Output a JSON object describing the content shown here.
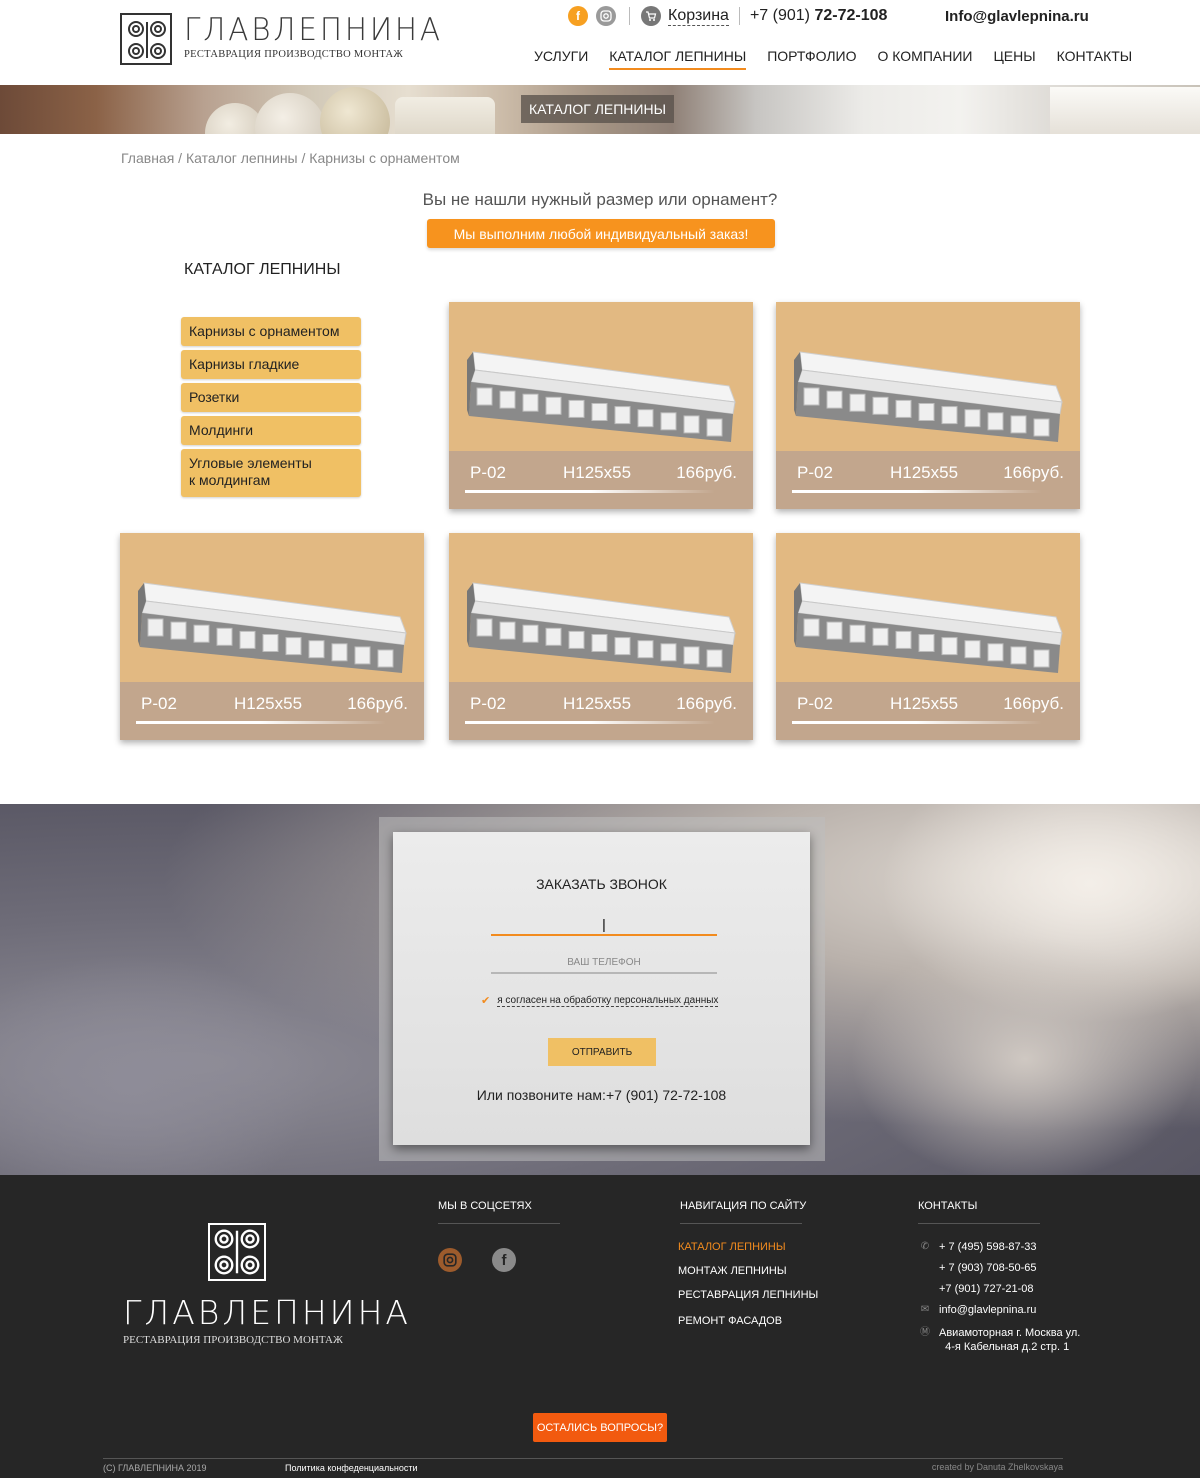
{
  "brand": {
    "name": "ГЛАВЛЕПНИНА",
    "tagline": "РЕСТАВРАЦИЯ ПРОИЗВОДСТВО МОНТАЖ"
  },
  "topbar": {
    "cart_label": "Корзина",
    "phone_prefix": "+7 (901)",
    "phone_number": "72-72-108",
    "email": "Info@glavlepnina.ru",
    "social_icons": [
      "facebook-icon",
      "instagram-icon"
    ]
  },
  "nav": {
    "items": [
      {
        "label": "УСЛУГИ",
        "active": false
      },
      {
        "label": "КАТАЛОГ ЛЕПНИНЫ",
        "active": true
      },
      {
        "label": "ПОРТФОЛИО",
        "active": false
      },
      {
        "label": "О КОМПАНИИ",
        "active": false
      },
      {
        "label": "ЦЕНЫ",
        "active": false
      },
      {
        "label": "КОНТАКТЫ",
        "active": false
      }
    ]
  },
  "banner": {
    "title": "КАТАЛОГ ЛЕПНИНЫ"
  },
  "breadcrumb": {
    "text": "Главная / Каталог лепнины / Карнизы с орнаментом"
  },
  "cta": {
    "question": "Вы не нашли нужный размер или орнамент?",
    "button": "Мы выполним любой индивидуальный заказ!"
  },
  "catalog": {
    "heading": "КАТАЛОГ ЛЕПНИНЫ",
    "menu": [
      {
        "label": "Карнизы с орнаментом"
      },
      {
        "label": "Карнизы гладкие"
      },
      {
        "label": "Розетки"
      },
      {
        "label": "Молдинги"
      },
      {
        "label": "Угловые элементы\nк молдингам"
      }
    ],
    "products": [
      {
        "code": "Р-02",
        "size": "Н125х55",
        "price": "166руб."
      },
      {
        "code": "Р-02",
        "size": "Н125х55",
        "price": "166руб."
      },
      {
        "code": "Р-02",
        "size": "Н125х55",
        "price": "166руб."
      },
      {
        "code": "Р-02",
        "size": "Н125х55",
        "price": "166руб."
      },
      {
        "code": "Р-02",
        "size": "Н125х55",
        "price": "166руб."
      }
    ]
  },
  "order_form": {
    "title": "ЗАКАЗАТЬ ЗВОНОК",
    "name_value": "|",
    "phone_placeholder": "ВАШ ТЕЛЕФОН",
    "agree_label": "я согласен на обработку персональных данных",
    "agree_checked": true,
    "submit": "ОТПРАВИТЬ",
    "call_prefix": "Или позвоните нам:",
    "call_phone": "+7 (901) 72-72-108"
  },
  "footer": {
    "social_heading": "МЫ В СОЦСЕТЯХ",
    "nav_heading": "НАВИГАЦИЯ ПО САЙТУ",
    "contacts_heading": "КОНТАКТЫ",
    "nav_items": [
      {
        "label": "КАТАЛОГ ЛЕПНИНЫ",
        "active": true
      },
      {
        "label": "МОНТАЖ ЛЕПНИНЫ",
        "active": false
      },
      {
        "label": "РЕСТАВРАЦИЯ ЛЕПНИНЫ",
        "active": false
      },
      {
        "label": "РЕМОНТ ФАСАДОВ",
        "active": false
      }
    ],
    "phones": [
      "+ 7 (495) 598-87-33",
      "+ 7 (903) 708-50-65",
      "+7 (901) 727-21-08"
    ],
    "email": "info@glavlepnina.ru",
    "address_line1": "Авиамоторная г. Москва ул.",
    "address_line2": "4-я Кабельная д.2 стр. 1",
    "questions_button": "ОСТАЛИСЬ ВОПРОСЫ?",
    "copyright": "(С) ГЛАВЛЕПНИНА 2019",
    "policy": "Политика конфеденциальности",
    "created_by": "created by Danuta Zhelkovskaya"
  },
  "colors": {
    "accent_orange": "#f7931e",
    "menu_yellow": "#f0c064",
    "card_bg": "#e2b982",
    "card_bar": "#c2a68d",
    "footer_bg": "#262626"
  }
}
